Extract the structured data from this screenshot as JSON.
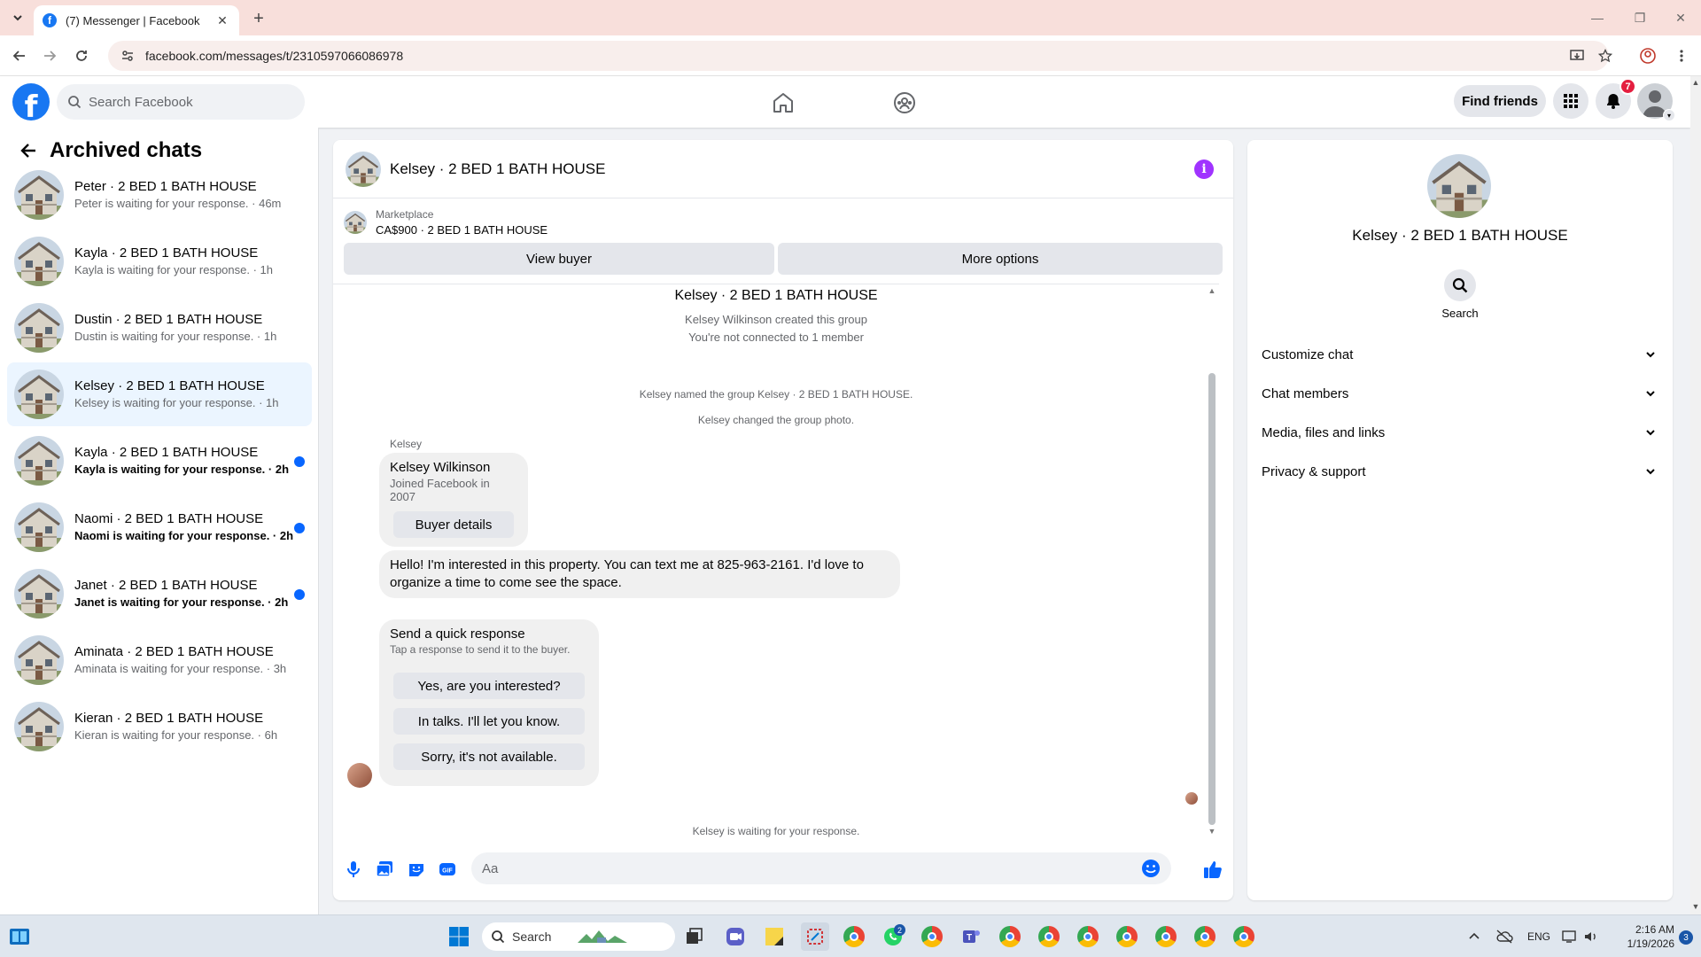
{
  "browser": {
    "tab_title": "(7) Messenger | Facebook",
    "url": "facebook.com/messages/t/2310597066086978"
  },
  "header": {
    "search_placeholder": "Search Facebook",
    "find_friends_label": "Find friends",
    "notifications_count": "7"
  },
  "sidebar": {
    "title": "Archived chats",
    "chats": [
      {
        "name": "Peter · 2 BED 1 BATH HOUSE",
        "snippet": "Peter is waiting for your response. · 46m",
        "unread": false,
        "active": false
      },
      {
        "name": "Kayla · 2 BED 1 BATH HOUSE",
        "snippet": "Kayla is waiting for your response. · 1h",
        "unread": false,
        "active": false
      },
      {
        "name": "Dustin · 2 BED 1 BATH HOUSE",
        "snippet": "Dustin is waiting for your response. · 1h",
        "unread": false,
        "active": false
      },
      {
        "name": "Kelsey · 2 BED 1 BATH HOUSE",
        "snippet": "Kelsey is waiting for your response. · 1h",
        "unread": false,
        "active": true
      },
      {
        "name": "Kayla · 2 BED 1 BATH HOUSE",
        "snippet": "Kayla is waiting for your response. · 2h",
        "unread": true,
        "active": false
      },
      {
        "name": "Naomi · 2 BED 1 BATH HOUSE",
        "snippet": "Naomi is waiting for your response. · 2h",
        "unread": true,
        "active": false
      },
      {
        "name": "Janet · 2 BED 1 BATH HOUSE",
        "snippet": "Janet is waiting for your response. · 2h",
        "unread": true,
        "active": false
      },
      {
        "name": "Aminata · 2 BED 1 BATH HOUSE",
        "snippet": "Aminata is waiting for your response. · 3h",
        "unread": false,
        "active": false
      },
      {
        "name": "Kieran · 2 BED 1 BATH HOUSE",
        "snippet": "Kieran is waiting for your response. · 6h",
        "unread": false,
        "active": false
      }
    ]
  },
  "conversation": {
    "title": "Kelsey · 2 BED 1 BATH HOUSE",
    "marketplace_label": "Marketplace",
    "listing": "CA$900 · 2 BED 1 BATH HOUSE",
    "view_buyer_label": "View buyer",
    "more_options_label": "More options",
    "intro_title": "Kelsey · 2 BED 1 BATH HOUSE",
    "intro_created": "Kelsey Wilkinson created this group",
    "intro_connected": "You're not connected to 1 member",
    "event_named": "Kelsey named the group Kelsey · 2 BED 1 BATH HOUSE.",
    "event_photo": "Kelsey changed the group photo.",
    "sender_name": "Kelsey",
    "profile_card": {
      "name": "Kelsey Wilkinson",
      "joined": "Joined Facebook in 2007",
      "button": "Buyer details"
    },
    "message_text": "Hello! I'm interested in this property. You can text me at 825-963-2161. I'd love to organize a time to come see the space.",
    "quick_response": {
      "title": "Send a quick response",
      "subtitle": "Tap a response to send it to the buyer.",
      "options": [
        "Yes, are you interested?",
        "In talks. I'll let you know.",
        "Sorry, it's not available."
      ]
    },
    "waiting_status": "Kelsey is waiting for your response.",
    "composer_placeholder": "Aa"
  },
  "info_panel": {
    "title": "Kelsey · 2 BED 1 BATH HOUSE",
    "search_label": "Search",
    "sections": [
      "Customize chat",
      "Chat members",
      "Media, files and links",
      "Privacy & support"
    ]
  },
  "taskbar": {
    "search_placeholder": "Search",
    "language": "ENG",
    "time": "2:16 AM",
    "date": "1/19/2026",
    "notification_count": "3",
    "whatsapp_badge": "2"
  },
  "colors": {
    "facebook_blue": "#1877f2",
    "unread_dot": "#0866ff",
    "info_purple": "#a033ff",
    "badge_red": "#e41e3f"
  }
}
